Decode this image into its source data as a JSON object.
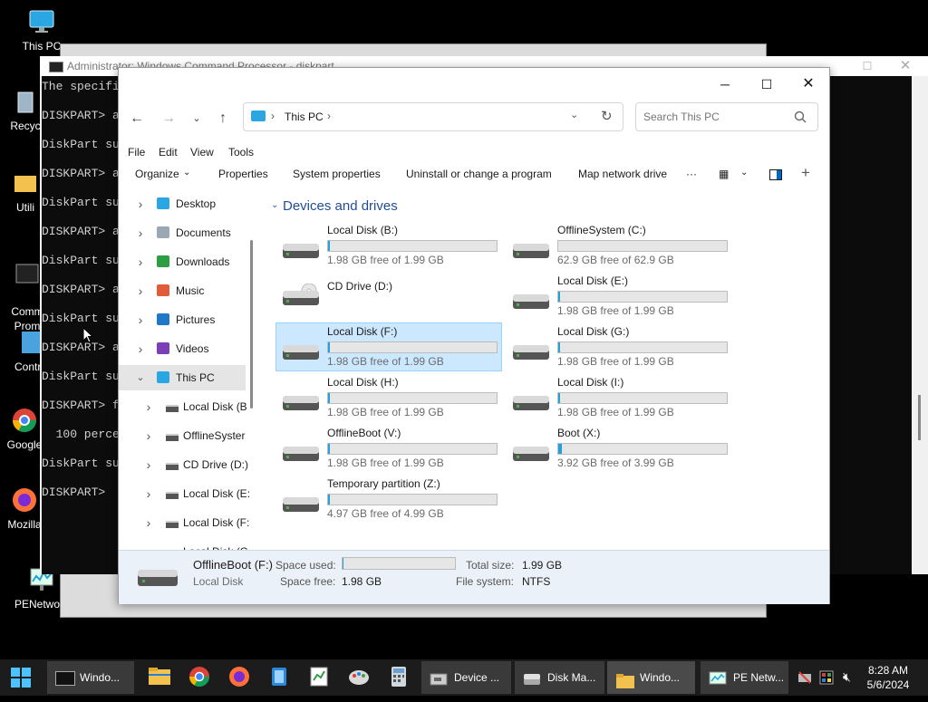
{
  "desktop": {
    "icons": [
      {
        "label": "This PC"
      },
      {
        "label": "Recyc"
      },
      {
        "label": "Utili"
      },
      {
        "label": "Comm\nProm"
      },
      {
        "label": "Contro"
      },
      {
        "label": "Google"
      },
      {
        "label": "Mozilla"
      },
      {
        "label": "PENetwork"
      }
    ]
  },
  "cmd_window": {
    "title": "Administrator: Windows Command Processor - diskpart",
    "lines": [
      "The specifi",
      "",
      "DISKPART> a",
      "",
      "DiskPart su",
      "",
      "DISKPART> a",
      "",
      "DiskPart su",
      "",
      "DISKPART> a",
      "",
      "DiskPart su",
      "",
      "DISKPART> a",
      "",
      "DiskPart su",
      "",
      "DISKPART> a",
      "",
      "DiskPart su",
      "",
      "DISKPART> f",
      "",
      "  100 perce",
      "",
      "DiskPart su",
      "",
      "DISKPART>"
    ]
  },
  "explorer": {
    "address": {
      "location": "This PC"
    },
    "search": {
      "placeholder": "Search This PC"
    },
    "menu": {
      "file": "File",
      "edit": "Edit",
      "view": "View",
      "tools": "Tools"
    },
    "commands": {
      "organize": "Organize",
      "properties": "Properties",
      "system_properties": "System properties",
      "uninstall": "Uninstall or change a program",
      "map_drive": "Map network drive",
      "more": "···"
    },
    "nav": [
      {
        "label": "Desktop"
      },
      {
        "label": "Documents"
      },
      {
        "label": "Downloads"
      },
      {
        "label": "Music"
      },
      {
        "label": "Pictures"
      },
      {
        "label": "Videos"
      },
      {
        "label": "This PC"
      },
      {
        "label": "Local Disk (B"
      },
      {
        "label": "OfflineSyster"
      },
      {
        "label": "CD Drive (D:)"
      },
      {
        "label": "Local Disk (E:"
      },
      {
        "label": "Local Disk (F:"
      },
      {
        "label": "Local Disk (G"
      }
    ],
    "section_title": "Devices and drives",
    "drives": [
      {
        "name": "Local Disk (B:)",
        "free": "1.98 GB free of 1.99 GB",
        "used_fraction": 0.01
      },
      {
        "name": "OfflineSystem (C:)",
        "free": "62.9 GB free of 62.9 GB",
        "used_fraction": 0.0
      },
      {
        "name": "CD Drive (D:)",
        "free": "",
        "used_fraction": null
      },
      {
        "name": "Local Disk (E:)",
        "free": "1.98 GB free of 1.99 GB",
        "used_fraction": 0.01
      },
      {
        "name": "Local Disk (F:)",
        "free": "1.98 GB free of 1.99 GB",
        "used_fraction": 0.01
      },
      {
        "name": "Local Disk (G:)",
        "free": "1.98 GB free of 1.99 GB",
        "used_fraction": 0.01
      },
      {
        "name": "Local Disk (H:)",
        "free": "1.98 GB free of 1.99 GB",
        "used_fraction": 0.01
      },
      {
        "name": "Local Disk (I:)",
        "free": "1.98 GB free of 1.99 GB",
        "used_fraction": 0.01
      },
      {
        "name": "OfflineBoot (V:)",
        "free": "1.98 GB free of 1.99 GB",
        "used_fraction": 0.01
      },
      {
        "name": "Boot (X:)",
        "free": "3.92 GB free of 3.99 GB",
        "used_fraction": 0.02
      },
      {
        "name": "Temporary partition (Z:)",
        "free": "4.97 GB free of 4.99 GB",
        "used_fraction": 0.004
      }
    ],
    "status": {
      "name": "OfflineBoot (F:)",
      "type": "Local Disk",
      "space_used_label": "Space used:",
      "space_free_label": "Space free:",
      "space_free": "1.98 GB",
      "total_size_label": "Total size:",
      "total_size": "1.99 GB",
      "file_system_label": "File system:",
      "file_system": "NTFS",
      "used_fraction": 0.01
    }
  },
  "taskbar": {
    "buttons": [
      {
        "label": "Windo..."
      },
      {
        "label": "Device ..."
      },
      {
        "label": "Disk Ma..."
      },
      {
        "label": "Windo..."
      },
      {
        "label": "PE Netw..."
      }
    ],
    "time": "8:28 AM",
    "date": "5/6/2024"
  },
  "colors": {
    "accent": "#26a0da",
    "selected_bg": "#cce8ff",
    "selected_border": "#99d1ff"
  }
}
